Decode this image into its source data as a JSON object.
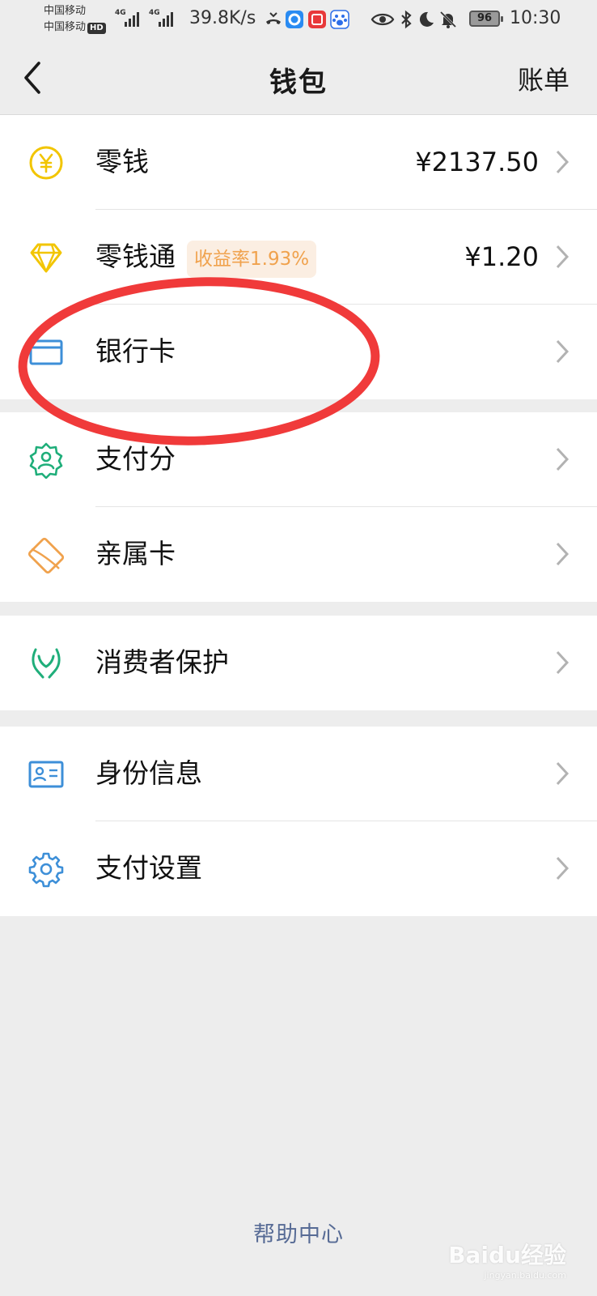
{
  "status_bar": {
    "carrier_1": "中国移动",
    "carrier_2": "中国移动",
    "hd_label": "HD",
    "net_1": "4G",
    "net_2": "4G",
    "speed": "39.8K/s",
    "battery": "96",
    "time": "10:30"
  },
  "nav": {
    "title": "钱包",
    "right_action": "账单"
  },
  "groups": [
    {
      "items": [
        {
          "label": "零钱",
          "value": "¥2137.50",
          "icon": "yen-coin-icon",
          "color": "#f2c500"
        },
        {
          "label": "零钱通",
          "badge": "收益率1.93%",
          "value": "¥1.20",
          "icon": "diamond-icon",
          "color": "#f2c500"
        },
        {
          "label": "银行卡",
          "icon": "bank-card-icon",
          "color": "#3d8fd8"
        }
      ]
    },
    {
      "items": [
        {
          "label": "支付分",
          "icon": "pay-score-badge-icon",
          "color": "#1fae7a"
        },
        {
          "label": "亲属卡",
          "icon": "family-card-icon",
          "color": "#f0a24d"
        }
      ]
    },
    {
      "items": [
        {
          "label": "消费者保护",
          "icon": "hands-protection-icon",
          "color": "#1fae7a"
        }
      ]
    },
    {
      "items": [
        {
          "label": "身份信息",
          "icon": "id-card-icon",
          "color": "#3d8fd8"
        },
        {
          "label": "支付设置",
          "icon": "gear-icon",
          "color": "#3d8fd8"
        }
      ]
    }
  ],
  "footer": {
    "help_link": "帮助中心"
  },
  "watermark": {
    "text": "Baidu经验",
    "sub": "jingyan.baidu.com"
  },
  "colors": {
    "background": "#ededed",
    "annotation": "#f03a3a",
    "link": "#576b95",
    "badge_text": "#f0a24d"
  }
}
